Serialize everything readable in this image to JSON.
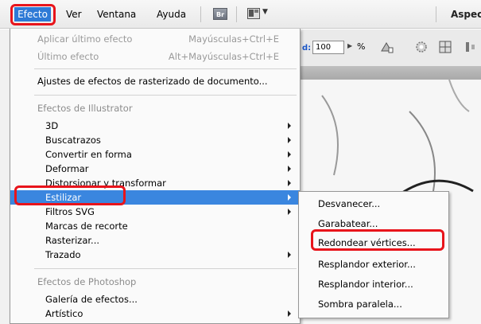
{
  "menubar": {
    "items": [
      "Efecto",
      "Ver",
      "Ventana",
      "Ayuda"
    ],
    "br_label": "Br",
    "right_label": "Aspect"
  },
  "toolbar": {
    "d_label": "d:",
    "zoom_value": "100",
    "percent": "%"
  },
  "menu": {
    "apply_last": {
      "label": "Aplicar último efecto",
      "shortcut": "Mayúsculas+Ctrl+E"
    },
    "last_effect": {
      "label": "Último efecto",
      "shortcut": "Alt+Mayúsculas+Ctrl+E"
    },
    "raster_settings": "Ajustes de efectos de rasterizado de documento...",
    "illustrator_header": "Efectos de Illustrator",
    "illustrator_items": [
      "3D",
      "Buscatrazos",
      "Convertir en forma",
      "Deformar",
      "Distorsionar y transformar",
      "Estilizar",
      "Filtros SVG",
      "Marcas de recorte",
      "Rasterizar...",
      "Trazado"
    ],
    "photoshop_header": "Efectos de Photoshop",
    "photoshop_items": [
      "Galería de efectos...",
      "Artístico"
    ]
  },
  "submenu": {
    "items": [
      "Desvanecer...",
      "Garabatear...",
      "Redondear vértices...",
      "Resplandor exterior...",
      "Resplandor interior...",
      "Sombra paralela..."
    ]
  },
  "colors": {
    "highlight": "#3a86df",
    "annotation_ring": "#e8141b"
  }
}
